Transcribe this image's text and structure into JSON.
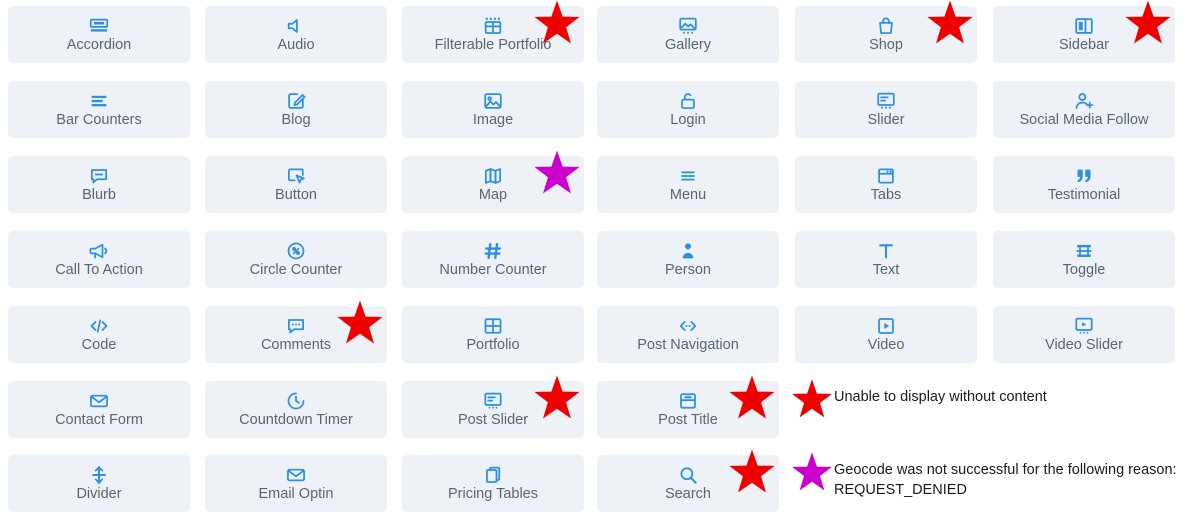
{
  "palette": {
    "card_background": "#eef2f7",
    "icon_blue": "#2a8fe0",
    "label_gray": "#596571",
    "star_red": "#ee0000",
    "star_magenta": "#cc00cc",
    "page_background": "#ffffff",
    "legend_text": "#1a1a1a"
  },
  "grid": {
    "columns": 6,
    "rows": 7,
    "modules": [
      {
        "label": "Accordion",
        "icon": "accordion-icon",
        "row": 1,
        "col": 1,
        "star": null
      },
      {
        "label": "Audio",
        "icon": "audio-speaker-icon",
        "row": 1,
        "col": 2,
        "star": null
      },
      {
        "label": "Filterable Portfolio",
        "icon": "filterable-grid-icon",
        "row": 1,
        "col": 3,
        "star": "red"
      },
      {
        "label": "Gallery",
        "icon": "gallery-image-icon",
        "row": 1,
        "col": 4,
        "star": null
      },
      {
        "label": "Shop",
        "icon": "shopping-bag-icon",
        "row": 1,
        "col": 5,
        "star": "red"
      },
      {
        "label": "Sidebar",
        "icon": "sidebar-columns-icon",
        "row": 1,
        "col": 6,
        "star": "red"
      },
      {
        "label": "Bar Counters",
        "icon": "bar-counters-icon",
        "row": 2,
        "col": 1,
        "star": null
      },
      {
        "label": "Blog",
        "icon": "blog-pencil-icon",
        "row": 2,
        "col": 2,
        "star": null
      },
      {
        "label": "Image",
        "icon": "image-picture-icon",
        "row": 2,
        "col": 3,
        "star": null
      },
      {
        "label": "Login",
        "icon": "login-lock-icon",
        "row": 2,
        "col": 4,
        "star": null
      },
      {
        "label": "Slider",
        "icon": "slider-panel-icon",
        "row": 2,
        "col": 5,
        "star": null
      },
      {
        "label": "Social Media Follow",
        "icon": "person-add-icon",
        "row": 2,
        "col": 6,
        "star": null
      },
      {
        "label": "Blurb",
        "icon": "blurb-bubble-icon",
        "row": 3,
        "col": 1,
        "star": null
      },
      {
        "label": "Button",
        "icon": "button-cursor-icon",
        "row": 3,
        "col": 2,
        "star": null
      },
      {
        "label": "Map",
        "icon": "map-fold-icon",
        "row": 3,
        "col": 3,
        "star": "magenta"
      },
      {
        "label": "Menu",
        "icon": "menu-lines-icon",
        "row": 3,
        "col": 4,
        "star": null
      },
      {
        "label": "Tabs",
        "icon": "tabs-window-icon",
        "row": 3,
        "col": 5,
        "star": null
      },
      {
        "label": "Testimonial",
        "icon": "quote-marks-icon",
        "row": 3,
        "col": 6,
        "star": null
      },
      {
        "label": "Call To Action",
        "icon": "megaphone-icon",
        "row": 4,
        "col": 1,
        "star": null
      },
      {
        "label": "Circle Counter",
        "icon": "circle-percent-icon",
        "row": 4,
        "col": 2,
        "star": null
      },
      {
        "label": "Number Counter",
        "icon": "hash-icon",
        "row": 4,
        "col": 3,
        "star": null
      },
      {
        "label": "Person",
        "icon": "person-icon",
        "row": 4,
        "col": 4,
        "star": null
      },
      {
        "label": "Text",
        "icon": "text-t-icon",
        "row": 4,
        "col": 5,
        "star": null
      },
      {
        "label": "Toggle",
        "icon": "toggle-stack-icon",
        "row": 4,
        "col": 6,
        "star": null
      },
      {
        "label": "Code",
        "icon": "code-brackets-icon",
        "row": 5,
        "col": 1,
        "star": null
      },
      {
        "label": "Comments",
        "icon": "comments-bubble-icon",
        "row": 5,
        "col": 2,
        "star": "red"
      },
      {
        "label": "Portfolio",
        "icon": "portfolio-grid-icon",
        "row": 5,
        "col": 3,
        "star": null
      },
      {
        "label": "Post Navigation",
        "icon": "post-navigation-icon",
        "row": 5,
        "col": 4,
        "star": null
      },
      {
        "label": "Video",
        "icon": "video-play-icon",
        "row": 5,
        "col": 5,
        "star": null
      },
      {
        "label": "Video Slider",
        "icon": "video-slider-icon",
        "row": 5,
        "col": 6,
        "star": null
      },
      {
        "label": "Contact Form",
        "icon": "envelope-icon",
        "row": 6,
        "col": 1,
        "star": null
      },
      {
        "label": "Countdown Timer",
        "icon": "clock-icon",
        "row": 6,
        "col": 2,
        "star": null
      },
      {
        "label": "Post Slider",
        "icon": "post-slider-icon",
        "row": 6,
        "col": 3,
        "star": "red"
      },
      {
        "label": "Post Title",
        "icon": "post-title-icon",
        "row": 6,
        "col": 4,
        "star": "red"
      },
      {
        "label": "Divider",
        "icon": "divider-arrows-icon",
        "row": 7,
        "col": 1,
        "star": null
      },
      {
        "label": "Email Optin",
        "icon": "envelope-icon",
        "row": 7,
        "col": 2,
        "star": null
      },
      {
        "label": "Pricing Tables",
        "icon": "pricing-tables-icon",
        "row": 7,
        "col": 3,
        "star": null
      },
      {
        "label": "Search",
        "icon": "search-magnifier-icon",
        "row": 7,
        "col": 4,
        "star": "red"
      }
    ]
  },
  "legend": [
    {
      "star": "red",
      "text": "Unable to display without content"
    },
    {
      "star": "magenta",
      "text": "Geocode was not successful for the following reason:\nREQUEST_DENIED"
    }
  ]
}
